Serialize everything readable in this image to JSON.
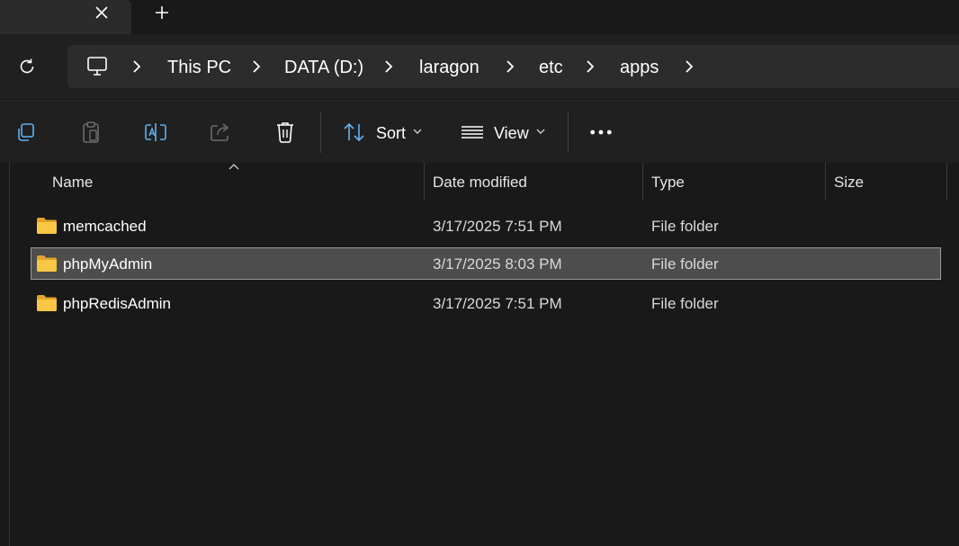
{
  "tabs": {
    "close_glyph": "✕",
    "new_tab_glyph": "+"
  },
  "address_bar": {
    "root_icon": "pc-icon",
    "breadcrumbs": [
      "This PC",
      "DATA (D:)",
      "laragon",
      "etc",
      "apps"
    ]
  },
  "command_bar": {
    "icons": [
      "copy-icon",
      "paste-icon",
      "rename-icon",
      "share-icon",
      "delete-icon"
    ],
    "sort_label": "Sort",
    "view_label": "View",
    "more_glyph": "•••"
  },
  "file_list": {
    "columns": [
      "Name",
      "Date modified",
      "Type",
      "Size"
    ],
    "sorted_by": "Name",
    "rows": [
      {
        "name": "memcached",
        "date": "3/17/2025 7:51 PM",
        "type": "File folder",
        "size": "",
        "selected": false
      },
      {
        "name": "phpMyAdmin",
        "date": "3/17/2025 8:03 PM",
        "type": "File folder",
        "size": "",
        "selected": true
      },
      {
        "name": "phpRedisAdmin",
        "date": "3/17/2025 7:51 PM",
        "type": "File folder",
        "size": "",
        "selected": false
      }
    ]
  },
  "colors": {
    "background": "#191919",
    "toolbar": "#202020",
    "address_box": "#2c2c2c",
    "selection": "#4d4d4d",
    "accent_blue": "#5fb2f2",
    "folder_yellow": "#f8c745"
  }
}
